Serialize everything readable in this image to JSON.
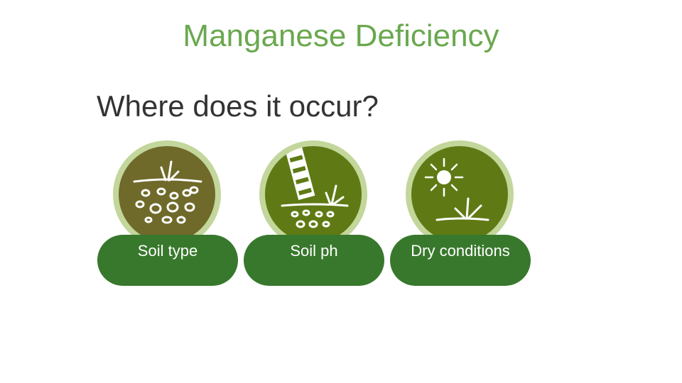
{
  "title": "Manganese Deficiency",
  "subtitle": "Where does it occur?",
  "cards": [
    {
      "label": "Soil type",
      "icon": "soil-stones-icon"
    },
    {
      "label": "Soil ph",
      "icon": "soil-ph-test-strip-icon"
    },
    {
      "label": "Dry conditions",
      "icon": "sun-dry-plant-icon"
    }
  ],
  "colors": {
    "title": "#6aa84f",
    "subtitle": "#333333",
    "ring": "#c3d69b",
    "pill": "#38782c",
    "disc_soil": "#6f6a2a",
    "disc_ph": "#5f7a14",
    "disc_dry": "#5f7a14"
  }
}
